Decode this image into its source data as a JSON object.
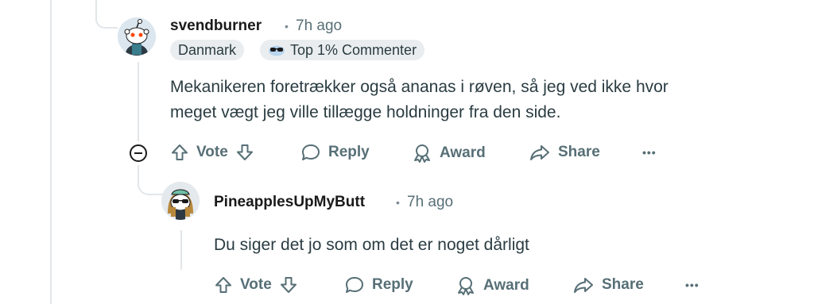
{
  "comment1": {
    "username": "svendburner",
    "separator": "•",
    "time": "7h ago",
    "flairs": {
      "country": "Danmark",
      "top_commenter_icon": "sunglasses-badge-icon",
      "top_commenter": "Top 1% Commenter"
    },
    "body_line1": "Mekanikeren foretrækker også ananas i røven, så jeg ved ikke hvor",
    "body_line2": "meget vægt jeg ville tillægge holdninger fra den side.",
    "actions": {
      "vote": "Vote",
      "reply": "Reply",
      "award": "Award",
      "share": "Share",
      "more": "•••"
    }
  },
  "comment2": {
    "username": "PineapplesUpMyButt",
    "separator": "•",
    "time": "7h ago",
    "body": "Du siger det jo som om det er noget dårligt",
    "actions": {
      "vote": "Vote",
      "reply": "Reply",
      "award": "Award",
      "share": "Share",
      "more": "•••"
    }
  },
  "colors": {
    "meta": "#576f76",
    "flair_bg": "#eaedef",
    "thread_line": "#e2e6e9"
  }
}
